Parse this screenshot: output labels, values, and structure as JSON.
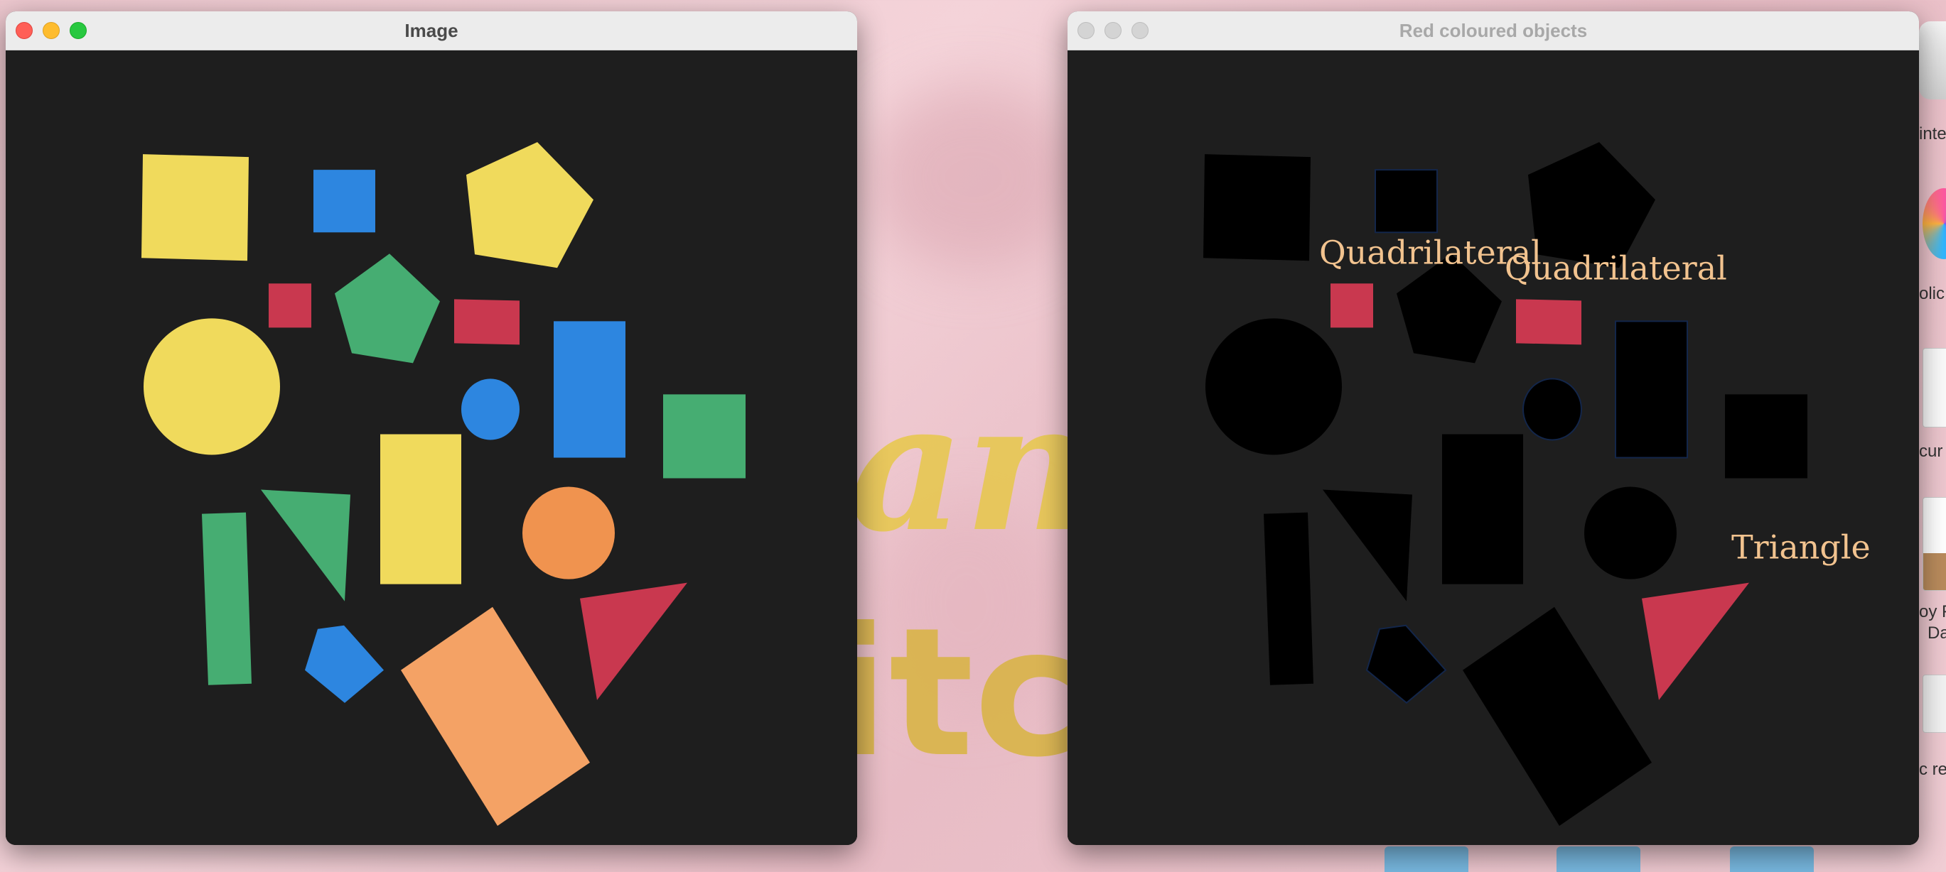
{
  "desktop": {
    "bg_text_1": "an",
    "bg_text_2": "itch",
    "side_labels": [
      "inte",
      "olic",
      "cur",
      "oy F",
      "Da",
      "c re"
    ]
  },
  "windows": {
    "image": {
      "title": "Image",
      "active": true
    },
    "red": {
      "title": "Red coloured objects",
      "active": false,
      "labels": [
        "Quadrilateral",
        "Quadrilateral",
        "Triangle"
      ]
    }
  },
  "colors": {
    "yellow": "#f0da5c",
    "blue": "#2d86e0",
    "red": "#c9384f",
    "green": "#46ad72",
    "orange_rect": "#f4a265",
    "orange_circle": "#f0934f",
    "label": "#f2c38f",
    "canvas": "#1e1e1e"
  }
}
